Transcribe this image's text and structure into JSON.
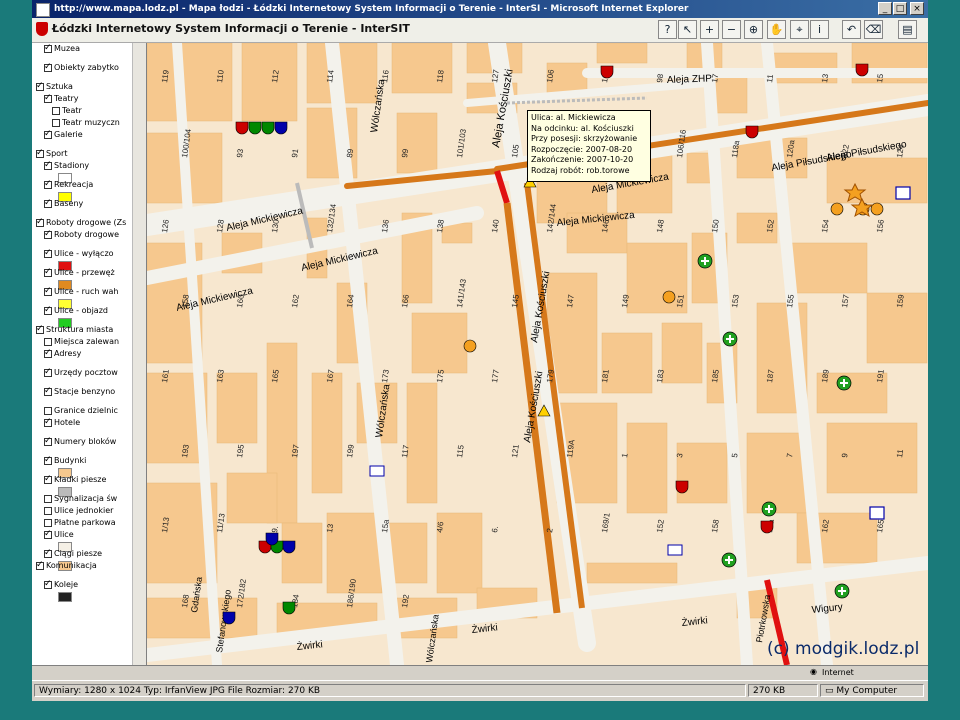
{
  "window": {
    "title": "http://www.mapa.lodz.pl - Mapa łodzi - Łódzki Internetowy System Informacji o Terenie - InterSI - Microsoft Internet Explorer",
    "controls": [
      "_",
      "□",
      "×"
    ]
  },
  "app": {
    "brand": "Łódzki Internetowy System Informacji o Terenie - InterSIT",
    "tools": [
      "?",
      "↖",
      "+",
      "−",
      "⊕",
      "✋",
      "⌖",
      "i",
      "↶",
      "⌫",
      "▤"
    ]
  },
  "layers": [
    {
      "label": "Muzea",
      "checked": true,
      "indent": 1,
      "swatch": ""
    },
    {
      "label": "Obiekty zabytko",
      "checked": true,
      "indent": 1,
      "swatch": ""
    },
    {
      "label": "Sztuka",
      "checked": true,
      "indent": 0,
      "swatch": ""
    },
    {
      "label": "Teatry",
      "checked": true,
      "indent": 1,
      "swatch": ""
    },
    {
      "label": "Teatr",
      "checked": false,
      "indent": 2,
      "swatch": ""
    },
    {
      "label": "Teatr muzyczn",
      "checked": false,
      "indent": 2,
      "swatch": ""
    },
    {
      "label": "Galerie",
      "checked": true,
      "indent": 1,
      "swatch": ""
    },
    {
      "label": "Sport",
      "checked": true,
      "indent": 0,
      "swatch": ""
    },
    {
      "label": "Stadiony",
      "checked": true,
      "indent": 1,
      "swatch": "#ffffff"
    },
    {
      "label": "Rekreacja",
      "checked": true,
      "indent": 1,
      "swatch": "#ffff00"
    },
    {
      "label": "Baseny",
      "checked": true,
      "indent": 1,
      "swatch": ""
    },
    {
      "label": "Roboty drogowe (Zs",
      "checked": true,
      "indent": 0,
      "swatch": ""
    },
    {
      "label": "Roboty drogowe",
      "checked": true,
      "indent": 1,
      "swatch": ""
    },
    {
      "label": "Ulice - wyłączo",
      "checked": true,
      "indent": 1,
      "swatch": "#e01010"
    },
    {
      "label": "Ulice - przewęż",
      "checked": true,
      "indent": 1,
      "swatch": "#e08a20"
    },
    {
      "label": "Ulice - ruch wah",
      "checked": true,
      "indent": 1,
      "swatch": "#ffff33"
    },
    {
      "label": "Ulice - objazd",
      "checked": true,
      "indent": 1,
      "swatch": "#22cc22"
    },
    {
      "label": "Struktura miasta",
      "checked": true,
      "indent": 0,
      "swatch": ""
    },
    {
      "label": "Miejsca zalewan",
      "checked": false,
      "indent": 1,
      "swatch": ""
    },
    {
      "label": "Adresy",
      "checked": true,
      "indent": 1,
      "swatch": ""
    },
    {
      "label": "Urzędy pocztow",
      "checked": true,
      "indent": 1,
      "swatch": ""
    },
    {
      "label": "Stacje benzyno",
      "checked": true,
      "indent": 1,
      "swatch": ""
    },
    {
      "label": "Granice dzielnic",
      "checked": false,
      "indent": 1,
      "swatch": ""
    },
    {
      "label": "Hotele",
      "checked": true,
      "indent": 1,
      "swatch": ""
    },
    {
      "label": "Numery bloków",
      "checked": true,
      "indent": 1,
      "swatch": ""
    },
    {
      "label": "Budynki",
      "checked": true,
      "indent": 1,
      "swatch": "#f6c88e"
    },
    {
      "label": "Kładki piesze",
      "checked": true,
      "indent": 1,
      "swatch": "#bbbbbb"
    },
    {
      "label": "Sygnalizacja św",
      "checked": false,
      "indent": 1,
      "swatch": ""
    },
    {
      "label": "Ulice jednokier",
      "checked": false,
      "indent": 1,
      "swatch": ""
    },
    {
      "label": "Płatne parkowa",
      "checked": false,
      "indent": 1,
      "swatch": ""
    },
    {
      "label": "Ulice",
      "checked": true,
      "indent": 1,
      "swatch": "#f5f0e6"
    },
    {
      "label": "Ciągi piesze",
      "checked": true,
      "indent": 1,
      "swatch": "#f6c88e"
    },
    {
      "label": "Komunikacja",
      "checked": true,
      "indent": 0,
      "swatch": ""
    },
    {
      "label": "Koleje",
      "checked": true,
      "indent": 1,
      "swatch": "#222222"
    }
  ],
  "tooltip": {
    "lines": [
      "Ulica: al. Mickiewicza",
      "Na odcinku: al. Kościuszki",
      "Przy posesji: skrzyżowanie",
      "Rozpoczęcie: 2007-08-20",
      "Zakończenie: 2007-10-20",
      "Rodzaj robót: rob.torowe"
    ]
  },
  "streets": [
    {
      "name": "Aleja Kościuszki"
    },
    {
      "name": "Aleja Kościuszki"
    },
    {
      "name": "Aleja Kościuszki"
    },
    {
      "name": "Aleja ZHP"
    },
    {
      "name": "Aleja Piłsudskiego"
    },
    {
      "name": "Aleja Piłsudskiego"
    },
    {
      "name": "Aleja Mickiewicza"
    },
    {
      "name": "Aleja Mickiewicza"
    },
    {
      "name": "Aleja Mickiewicza"
    },
    {
      "name": "Aleja Mickiewicza"
    },
    {
      "name": "Wólczańska"
    },
    {
      "name": "Wólczańska"
    },
    {
      "name": "Wólczańska"
    },
    {
      "name": "Gdańska"
    },
    {
      "name": "Stefanowskiego"
    },
    {
      "name": "Żwirki"
    },
    {
      "name": "Żwirki"
    },
    {
      "name": "Żwirki"
    },
    {
      "name": "Wigury"
    },
    {
      "name": "Piotrkowska"
    },
    {
      "name": "Aleja Mickiewicza"
    }
  ],
  "house_numbers": [
    "119",
    "110",
    "112",
    "114",
    "116",
    "118",
    "127",
    "106",
    "108",
    "98",
    "17",
    "11",
    "13",
    "15",
    "100/104",
    "93",
    "91",
    "89",
    "99",
    "101/103",
    "105",
    "107/113",
    "104A",
    "106/116",
    "118a",
    "120a",
    "122",
    "124",
    "126",
    "128",
    "130",
    "132/134",
    "136",
    "138",
    "140",
    "142/144",
    "146",
    "148",
    "150",
    "152",
    "154",
    "156",
    "158",
    "160",
    "162",
    "164",
    "166",
    "141/143",
    "145",
    "147",
    "149",
    "151",
    "153",
    "155",
    "157",
    "159",
    "161",
    "163",
    "165",
    "167",
    "173",
    "175",
    "177",
    "179",
    "181",
    "183",
    "185",
    "187",
    "189",
    "191",
    "193",
    "195",
    "197",
    "199",
    "117",
    "115",
    "121",
    "119A",
    "1",
    "3",
    "5",
    "7",
    "9",
    "11",
    "1/13",
    "11/13",
    "9.",
    "13",
    "15a",
    "4/6",
    "6.",
    "2",
    "169/1",
    "152",
    "158",
    "15a",
    "162",
    "165",
    "168",
    "172/182",
    "184",
    "186/190",
    "192"
  ],
  "watermark": "(c) modgik.lodz.pl",
  "ie_status": "Internet",
  "status": {
    "info": "Wymiary: 1280 x 1024 Typ: IrfanView JPG File Rozmiar: 270 KB",
    "size": "270 KB",
    "computer": "My Computer"
  }
}
